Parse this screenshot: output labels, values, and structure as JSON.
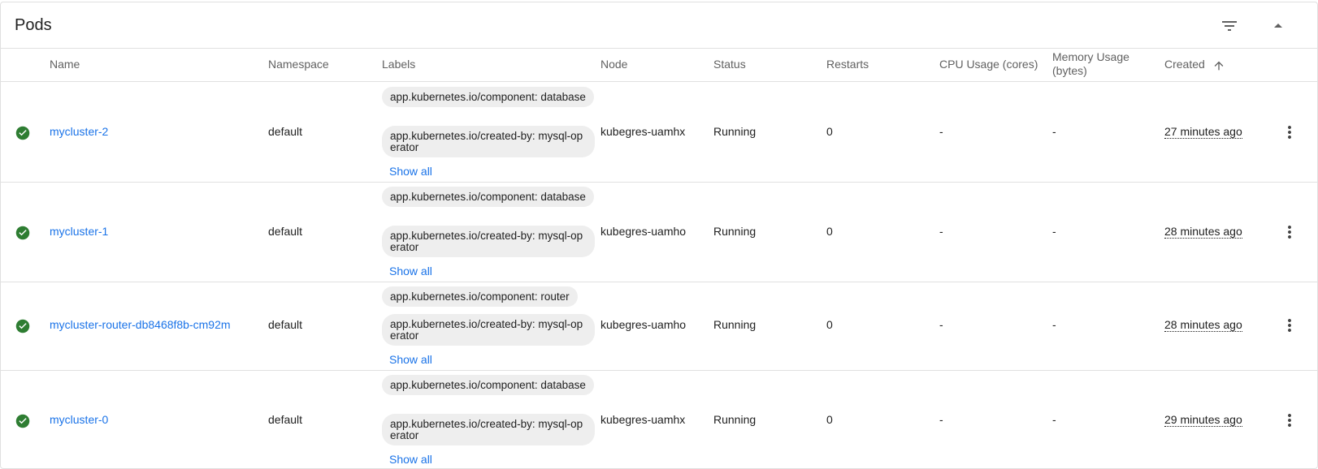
{
  "header": {
    "title": "Pods"
  },
  "columns": {
    "name": "Name",
    "namespace": "Namespace",
    "labels": "Labels",
    "node": "Node",
    "status": "Status",
    "restarts": "Restarts",
    "cpu": "CPU Usage (cores)",
    "memory_line1": "Memory Usage",
    "memory_line2": "(bytes)",
    "created": "Created"
  },
  "rows": [
    {
      "name": "mycluster-2",
      "namespace": "default",
      "labels": [
        "app.kubernetes.io/component: database",
        "app.kubernetes.io/created-by: mysql-operator"
      ],
      "show_all": "Show all",
      "node": "kubegres-uamhx",
      "status": "Running",
      "restarts": "0",
      "cpu": "-",
      "memory": "-",
      "created": "27 minutes ago"
    },
    {
      "name": "mycluster-1",
      "namespace": "default",
      "labels": [
        "app.kubernetes.io/component: database",
        "app.kubernetes.io/created-by: mysql-operator"
      ],
      "show_all": "Show all",
      "node": "kubegres-uamho",
      "status": "Running",
      "restarts": "0",
      "cpu": "-",
      "memory": "-",
      "created": "28 minutes ago"
    },
    {
      "name": "mycluster-router-db8468f8b-cm92m",
      "namespace": "default",
      "labels": [
        "app.kubernetes.io/component: router",
        "app.kubernetes.io/created-by: mysql-operator"
      ],
      "show_all": "Show all",
      "node": "kubegres-uamho",
      "status": "Running",
      "restarts": "0",
      "cpu": "-",
      "memory": "-",
      "created": "28 minutes ago"
    },
    {
      "name": "mycluster-0",
      "namespace": "default",
      "labels": [
        "app.kubernetes.io/component: database",
        "app.kubernetes.io/created-by: mysql-operator"
      ],
      "show_all": "Show all",
      "node": "kubegres-uamhx",
      "status": "Running",
      "restarts": "0",
      "cpu": "-",
      "memory": "-",
      "created": "29 minutes ago"
    }
  ],
  "icons": {
    "filter": "filter-list-icon",
    "collapse": "arrow-drop-up-icon",
    "sort": "arrow-upward-icon",
    "status": "check-circle-icon",
    "more": "more-vert-icon"
  },
  "colors": {
    "link": "#1a73e8",
    "success": "#2e7d32",
    "chip_bg": "#eeeeee",
    "border": "#e0e0e0"
  }
}
